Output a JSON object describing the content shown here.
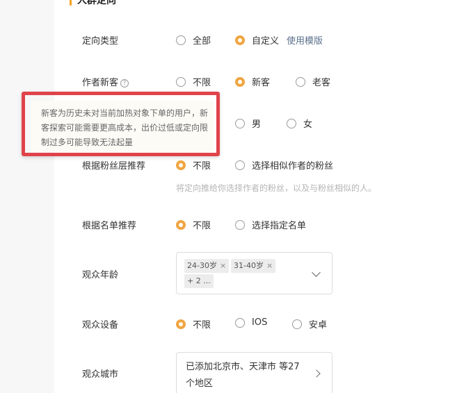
{
  "section": {
    "title": "人群定向"
  },
  "rows": {
    "targeting_type": {
      "label": "定向类型",
      "options": [
        "全部",
        "自定义"
      ],
      "selected": "自定义",
      "template_link": "使用模版"
    },
    "author_new_customer": {
      "label": "作者新客",
      "help": "?",
      "options": [
        "不限",
        "新客",
        "老客"
      ],
      "selected": "新客"
    },
    "gender": {
      "options": [
        "男",
        "女"
      ],
      "selected": null
    },
    "fan_layer": {
      "label": "根据粉丝层推荐",
      "options": [
        "不限",
        "选择相似作者的粉丝"
      ],
      "selected": "不限",
      "hint": "将定向推给你选择作者的粉丝，以及与粉丝相似的人。"
    },
    "name_list": {
      "label": "根据名单推荐",
      "options": [
        "不限",
        "选择指定名单"
      ],
      "selected": "不限"
    },
    "audience_age": {
      "label": "观众年龄",
      "tags": [
        "24-30岁",
        "31-40岁"
      ],
      "more": "+ 2 ...",
      "remove_glyph": "×"
    },
    "audience_device": {
      "label": "观众设备",
      "options": [
        "不限",
        "IOS",
        "安卓"
      ],
      "selected": "不限"
    },
    "audience_city": {
      "label": "观众城市",
      "value": "已添加北京市、天津市 等27个地区"
    }
  },
  "tooltip": {
    "text": "新客为历史未对当前加热对象下单的用户，新客探索可能需要更高成本，出价过低或定向限制过多可能导致无法起量"
  },
  "colors": {
    "accent": "#f0a541",
    "highlight": "#e0434a",
    "link": "#5a6f8c"
  }
}
